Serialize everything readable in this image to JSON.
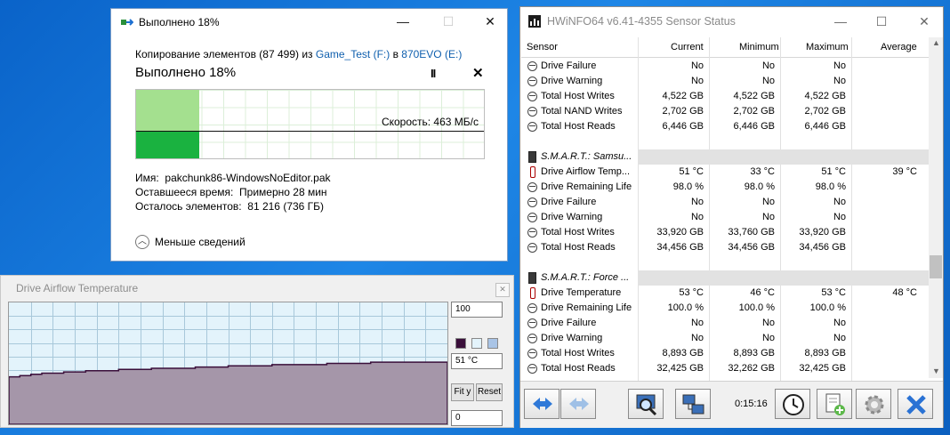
{
  "copy_dialog": {
    "title": "Выполнено 18%",
    "copying_prefix": "Копирование элементов (87 499) из ",
    "source": "Game_Test (F:)",
    "to_word": " в ",
    "destination": "870EVO (E:)",
    "progress_title": "Выполнено 18%",
    "progress_fraction": 0.18,
    "speed": "Скорость: 463 МБ/с",
    "name_label": "Имя:",
    "name_value": "pakchunk86-WindowsNoEditor.pak",
    "time_label": "Оставшееся время:",
    "time_value": "Примерно 28 мин",
    "items_label": "Осталось элементов:",
    "items_value": "81 216 (736 ГБ)",
    "less_details": "Меньше сведений",
    "pause_glyph": "II",
    "cancel_glyph": "✕"
  },
  "graph_window": {
    "title": "Drive Airflow Temperature",
    "max_value": "100",
    "current_value": "51 °C",
    "min_value": "0",
    "fit_label": "Fit y",
    "reset_label": "Reset",
    "colors": {
      "line": "#3a0f3a",
      "fill": "#a596a9",
      "background": "#e3f3fb",
      "grid": "#a8c8da"
    },
    "close_glyph": "✕"
  },
  "hwinfo": {
    "title": "HWiNFO64 v6.41-4355 Sensor Status",
    "columns": [
      "Sensor",
      "Current",
      "Minimum",
      "Maximum",
      "Average"
    ],
    "rows": [
      {
        "type": "sensor",
        "icon": "sensor-icon",
        "name": "Drive Failure",
        "current": "No",
        "minimum": "No",
        "maximum": "No",
        "average": ""
      },
      {
        "type": "sensor",
        "icon": "sensor-icon",
        "name": "Drive Warning",
        "current": "No",
        "minimum": "No",
        "maximum": "No",
        "average": ""
      },
      {
        "type": "sensor",
        "icon": "sensor-icon",
        "name": "Total Host Writes",
        "current": "4,522 GB",
        "minimum": "4,522 GB",
        "maximum": "4,522 GB",
        "average": ""
      },
      {
        "type": "sensor",
        "icon": "sensor-icon",
        "name": "Total NAND Writes",
        "current": "2,702 GB",
        "minimum": "2,702 GB",
        "maximum": "2,702 GB",
        "average": ""
      },
      {
        "type": "sensor",
        "icon": "sensor-icon",
        "name": "Total Host Reads",
        "current": "6,446 GB",
        "minimum": "6,446 GB",
        "maximum": "6,446 GB",
        "average": ""
      },
      {
        "type": "spacer"
      },
      {
        "type": "group",
        "icon": "drive-icon",
        "name": "S.M.A.R.T.: Samsu..."
      },
      {
        "type": "sensor",
        "icon": "thermometer-icon",
        "name": "Drive Airflow Temp...",
        "current": "51 °C",
        "minimum": "33 °C",
        "maximum": "51 °C",
        "average": "39 °C"
      },
      {
        "type": "sensor",
        "icon": "sensor-icon",
        "name": "Drive Remaining Life",
        "current": "98.0 %",
        "minimum": "98.0 %",
        "maximum": "98.0 %",
        "average": ""
      },
      {
        "type": "sensor",
        "icon": "sensor-icon",
        "name": "Drive Failure",
        "current": "No",
        "minimum": "No",
        "maximum": "No",
        "average": ""
      },
      {
        "type": "sensor",
        "icon": "sensor-icon",
        "name": "Drive Warning",
        "current": "No",
        "minimum": "No",
        "maximum": "No",
        "average": ""
      },
      {
        "type": "sensor",
        "icon": "sensor-icon",
        "name": "Total Host Writes",
        "current": "33,920 GB",
        "minimum": "33,760 GB",
        "maximum": "33,920 GB",
        "average": ""
      },
      {
        "type": "sensor",
        "icon": "sensor-icon",
        "name": "Total Host Reads",
        "current": "34,456 GB",
        "minimum": "34,456 GB",
        "maximum": "34,456 GB",
        "average": ""
      },
      {
        "type": "spacer"
      },
      {
        "type": "group",
        "icon": "drive-icon",
        "name": "S.M.A.R.T.: Force ..."
      },
      {
        "type": "sensor",
        "icon": "thermometer-icon",
        "name": "Drive Temperature",
        "current": "53 °C",
        "minimum": "46 °C",
        "maximum": "53 °C",
        "average": "48 °C"
      },
      {
        "type": "sensor",
        "icon": "sensor-icon",
        "name": "Drive Remaining Life",
        "current": "100.0 %",
        "minimum": "100.0 %",
        "maximum": "100.0 %",
        "average": ""
      },
      {
        "type": "sensor",
        "icon": "sensor-icon",
        "name": "Drive Failure",
        "current": "No",
        "minimum": "No",
        "maximum": "No",
        "average": ""
      },
      {
        "type": "sensor",
        "icon": "sensor-icon",
        "name": "Drive Warning",
        "current": "No",
        "minimum": "No",
        "maximum": "No",
        "average": ""
      },
      {
        "type": "sensor",
        "icon": "sensor-icon",
        "name": "Total Host Writes",
        "current": "8,893 GB",
        "minimum": "8,893 GB",
        "maximum": "8,893 GB",
        "average": ""
      },
      {
        "type": "sensor",
        "icon": "sensor-icon",
        "name": "Total Host Reads",
        "current": "32,425 GB",
        "minimum": "32,262 GB",
        "maximum": "32,425 GB",
        "average": ""
      }
    ],
    "timer": "0:15:16"
  }
}
